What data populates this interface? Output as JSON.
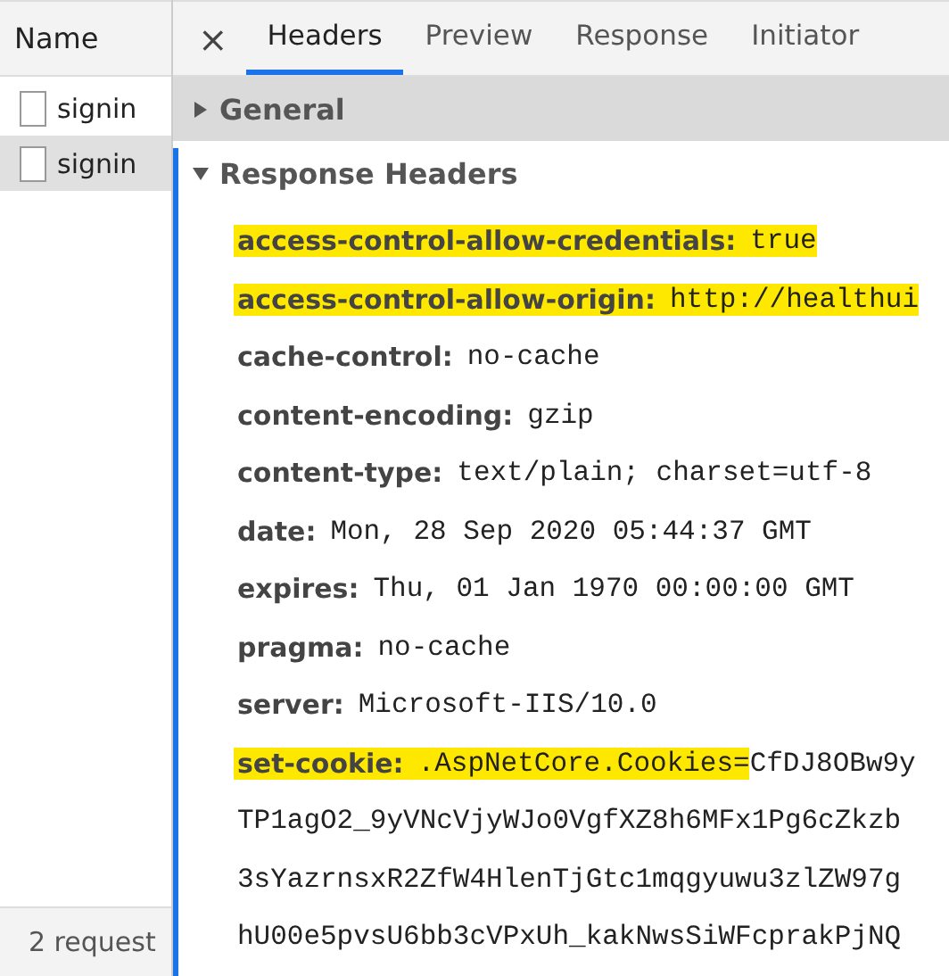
{
  "requests": {
    "column": "Name",
    "rows": [
      {
        "name": "signin",
        "selected": false
      },
      {
        "name": "signin",
        "selected": true
      }
    ],
    "status": "2 request"
  },
  "tabs": [
    {
      "label": "Headers",
      "selected": true
    },
    {
      "label": "Preview",
      "selected": false
    },
    {
      "label": "Response",
      "selected": false
    },
    {
      "label": "Initiator",
      "selected": false
    }
  ],
  "close_label": "×",
  "sections": [
    {
      "title": "General",
      "expanded": false
    },
    {
      "title": "Response Headers",
      "expanded": true,
      "headers": [
        {
          "name": "access-control-allow-credentials:",
          "highlighted": true,
          "value": [
            {
              "text": "true",
              "highlighted": true
            }
          ]
        },
        {
          "name": "access-control-allow-origin:",
          "highlighted": true,
          "value": [
            {
              "text": "http://healthui",
              "highlighted": true
            }
          ]
        },
        {
          "name": "cache-control:",
          "highlighted": false,
          "value": [
            {
              "text": "no-cache",
              "highlighted": false
            }
          ]
        },
        {
          "name": "content-encoding:",
          "highlighted": false,
          "value": [
            {
              "text": "gzip",
              "highlighted": false
            }
          ]
        },
        {
          "name": "content-type:",
          "highlighted": false,
          "value": [
            {
              "text": "text/plain; charset=utf-8",
              "highlighted": false
            }
          ]
        },
        {
          "name": "date:",
          "highlighted": false,
          "value": [
            {
              "text": "Mon, 28 Sep 2020 05:44:37 GMT",
              "highlighted": false
            }
          ]
        },
        {
          "name": "expires:",
          "highlighted": false,
          "value": [
            {
              "text": "Thu, 01 Jan 1970 00:00:00 GMT",
              "highlighted": false
            }
          ]
        },
        {
          "name": "pragma:",
          "highlighted": false,
          "value": [
            {
              "text": "no-cache",
              "highlighted": false
            }
          ]
        },
        {
          "name": "server:",
          "highlighted": false,
          "value": [
            {
              "text": "Microsoft-IIS/10.0",
              "highlighted": false
            }
          ]
        },
        {
          "name": "set-cookie:",
          "highlighted": true,
          "value": [
            {
              "text": ".AspNetCore.Cookies=",
              "highlighted": true
            },
            {
              "text": "CfDJ8OBw9y",
              "highlighted": false
            }
          ],
          "continuation": [
            "TP1agO2_9yVNcVjyWJo0VgfXZ8h6MFx1Pg6cZkzb",
            "3sYazrnsxR2ZfW4HlenTjGtc1mqgyuwu3zlZW97g",
            "hU00e5pvsU6bb3cVPxUh_kakNwsSiWFcprakPjNQ"
          ]
        }
      ]
    }
  ]
}
